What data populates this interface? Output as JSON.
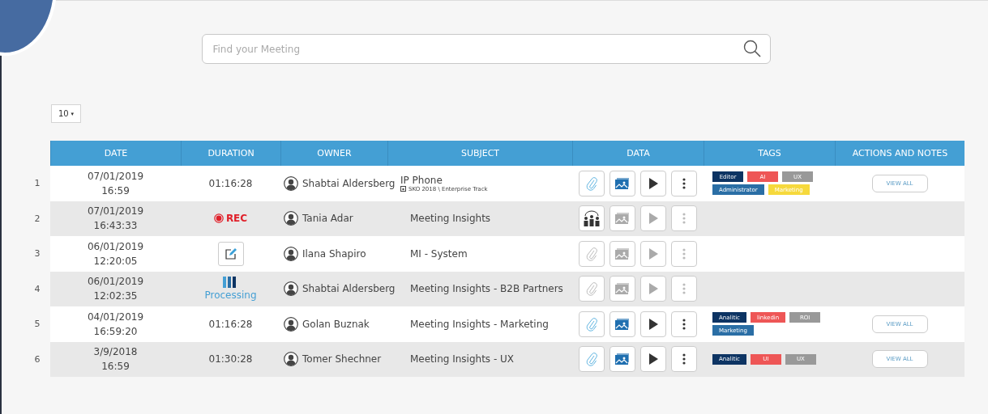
{
  "search": {
    "placeholder": "Find your Meeting"
  },
  "page_size": {
    "value": "10",
    "caret": "▾"
  },
  "table": {
    "columns": [
      "DATE",
      "DURATION",
      "OWNER",
      "SUBJECT",
      "DATA",
      "TAGS",
      "ACTIONS AND NOTES"
    ],
    "rows": [
      {
        "index": "1",
        "date": "07/01/2019",
        "time": "16:59",
        "duration": {
          "kind": "time",
          "text": "01:16:28"
        },
        "owner": "Shabtai Aldersberg",
        "subject": "IP Phone",
        "subtitle": "SKO 2018 \\ Enterprise Track",
        "data": [
          {
            "kind": "attach",
            "disabled": false
          },
          {
            "kind": "media",
            "disabled": false
          },
          {
            "kind": "play",
            "disabled": false
          },
          {
            "kind": "more",
            "disabled": false
          }
        ],
        "tags": [
          {
            "label": "Editor",
            "color": "#0d3463"
          },
          {
            "label": "AI",
            "color": "#ee5656"
          },
          {
            "label": "UX",
            "color": "#999999"
          },
          {
            "label": "Administrator",
            "color": "#2a6ea5"
          },
          {
            "label": "Marketing",
            "color": "#f6d93c"
          }
        ],
        "action": "VIEW ALL"
      },
      {
        "index": "2",
        "date": "07/01/2019",
        "time": "16:43:33",
        "duration": {
          "kind": "rec",
          "text": "REC"
        },
        "owner": "Tania Adar",
        "subject": "Meeting Insights",
        "data": [
          {
            "kind": "people",
            "disabled": false
          },
          {
            "kind": "media",
            "disabled": true
          },
          {
            "kind": "play",
            "disabled": true
          },
          {
            "kind": "more",
            "disabled": true
          }
        ]
      },
      {
        "index": "3",
        "date": "06/01/2019",
        "time": "12:20:05",
        "duration": {
          "kind": "edit"
        },
        "owner": "Ilana Shapiro",
        "subject": "MI - System",
        "data": [
          {
            "kind": "attach",
            "disabled": true
          },
          {
            "kind": "media",
            "disabled": true
          },
          {
            "kind": "play",
            "disabled": true
          },
          {
            "kind": "more",
            "disabled": true
          }
        ]
      },
      {
        "index": "4",
        "date": "06/01/2019",
        "time": "12:02:35",
        "duration": {
          "kind": "processing",
          "text": "Processing"
        },
        "owner": "Shabtai Aldersberg",
        "subject": "Meeting Insights - B2B Partners",
        "data": [
          {
            "kind": "attach",
            "disabled": true
          },
          {
            "kind": "media",
            "disabled": true
          },
          {
            "kind": "play",
            "disabled": true
          },
          {
            "kind": "more",
            "disabled": true
          }
        ]
      },
      {
        "index": "5",
        "date": "04/01/2019",
        "time": "16:59:20",
        "duration": {
          "kind": "time",
          "text": "01:16:28"
        },
        "owner": "Golan Buznak",
        "subject": "Meeting Insights - Marketing",
        "data": [
          {
            "kind": "attach",
            "disabled": false
          },
          {
            "kind": "media",
            "disabled": false
          },
          {
            "kind": "play",
            "disabled": false
          },
          {
            "kind": "more",
            "disabled": false
          }
        ],
        "tags": [
          {
            "label": "Analitic",
            "color": "#0d3463"
          },
          {
            "label": "linkedin",
            "color": "#ee5656"
          },
          {
            "label": "ROI",
            "color": "#999999"
          },
          {
            "label": "Marketing",
            "color": "#2a6ea5"
          }
        ],
        "action": "VIEW ALL"
      },
      {
        "index": "6",
        "date": "3/9/2018",
        "time": "16:59",
        "duration": {
          "kind": "time",
          "text": "01:30:28"
        },
        "owner": "Tomer Shechner",
        "subject": "Meeting Insights - UX",
        "data": [
          {
            "kind": "attach",
            "disabled": false
          },
          {
            "kind": "media",
            "disabled": false
          },
          {
            "kind": "play",
            "disabled": false
          },
          {
            "kind": "more",
            "disabled": false
          }
        ],
        "tags": [
          {
            "label": "Analitic",
            "color": "#0d3463"
          },
          {
            "label": "UI",
            "color": "#ee5656"
          },
          {
            "label": "UX",
            "color": "#999999"
          }
        ],
        "action": "VIEW ALL"
      }
    ]
  }
}
